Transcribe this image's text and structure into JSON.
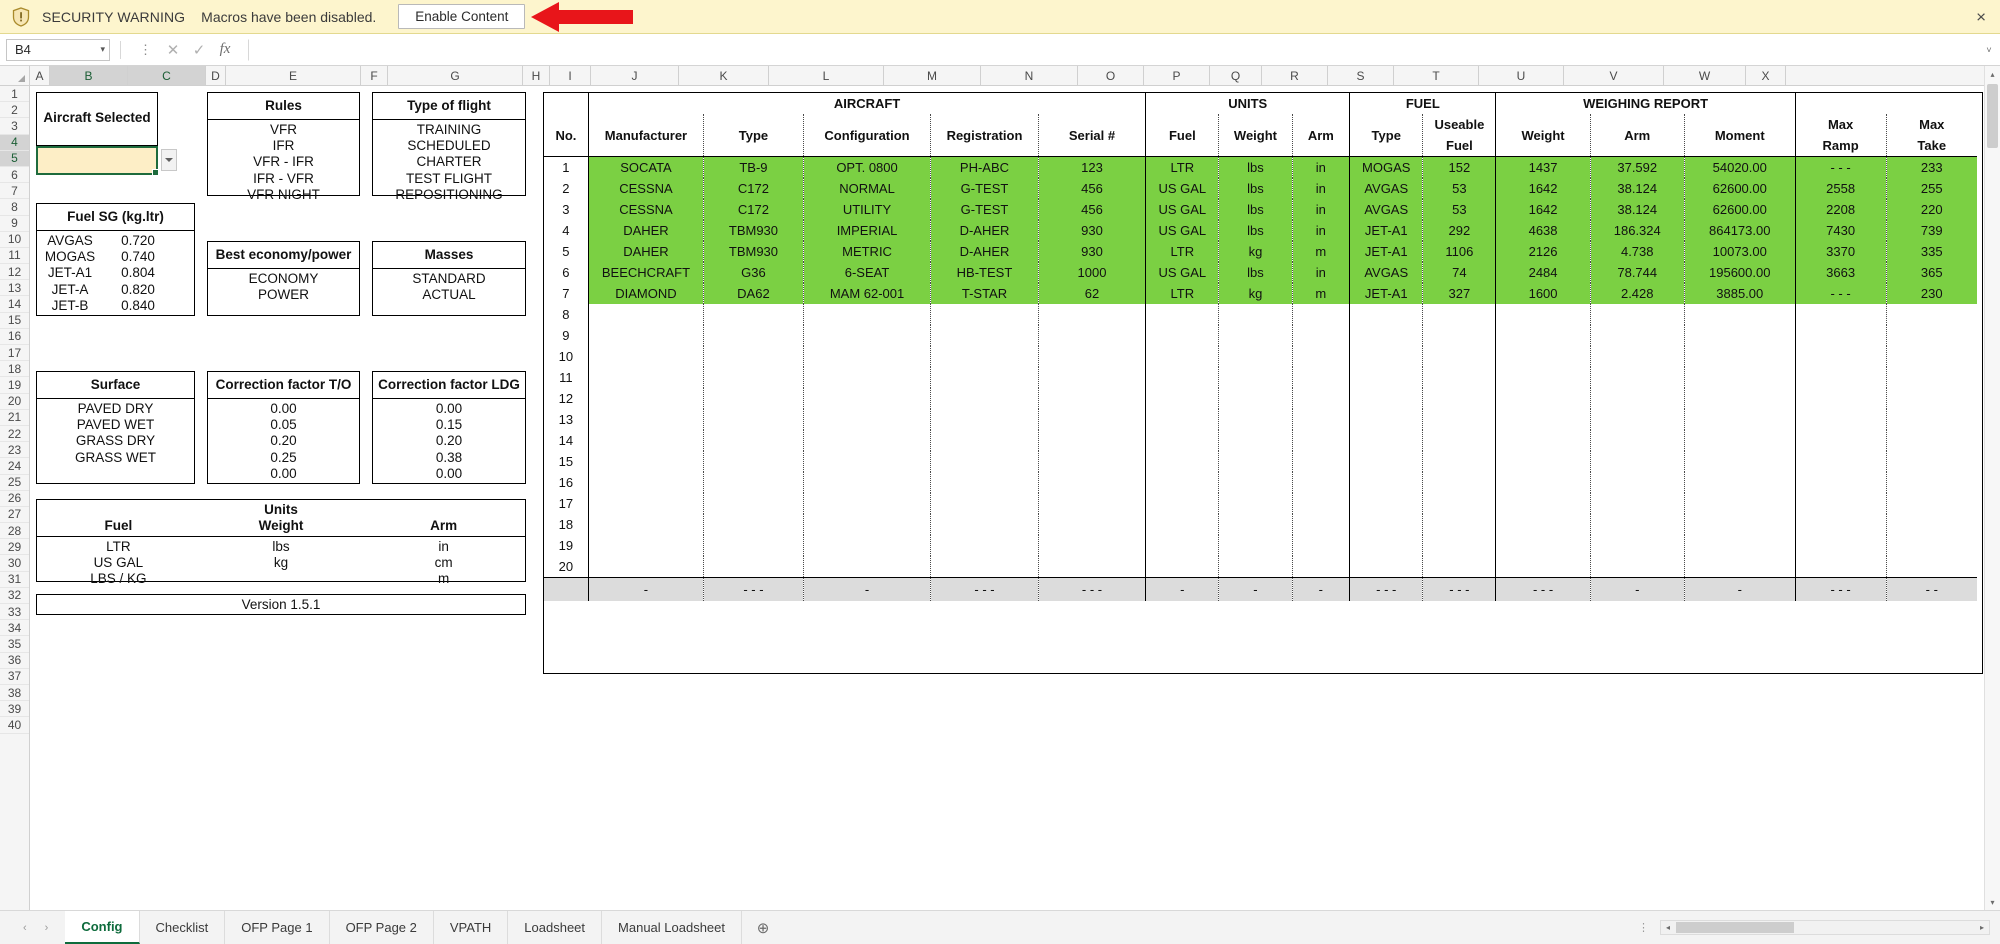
{
  "security_bar": {
    "icon": "shield-warning-icon",
    "title": "SECURITY WARNING",
    "message": "Macros have been disabled.",
    "button_label": "Enable Content",
    "close_label": "×",
    "background": "#fdf5cd",
    "arrow_color": "#e8151a"
  },
  "formula_bar": {
    "name_box_value": "B4",
    "name_box_chevron": "▾",
    "dots_icon": "more-options-icon",
    "cancel_icon": "✕",
    "confirm_icon": "✓",
    "function_icon": "fx",
    "formula_value": "",
    "expand_icon": "˅"
  },
  "grid": {
    "columns": [
      "A",
      "B",
      "C",
      "D",
      "E",
      "F",
      "G",
      "H",
      "I",
      "J",
      "K",
      "L",
      "M",
      "N",
      "O",
      "P",
      "Q",
      "R",
      "S",
      "T",
      "U",
      "V",
      "W",
      "X"
    ],
    "selected_columns": [
      "B",
      "C"
    ],
    "rows": [
      1,
      2,
      3,
      4,
      5,
      6,
      7,
      8,
      9,
      10,
      11,
      12,
      13,
      14,
      15,
      16,
      17,
      18,
      19,
      20,
      21,
      22,
      23,
      24,
      25,
      26,
      27,
      28,
      29,
      30,
      31,
      32,
      33,
      34,
      35,
      36,
      37,
      38,
      39,
      40
    ],
    "selected_rows": [
      4,
      5
    ]
  },
  "config": {
    "aircraft_selected": {
      "title": "Aircraft Selected",
      "value": "",
      "dropdown_icon": "chevron-down-icon"
    },
    "fuel_sg": {
      "title": "Fuel SG (kg.ltr)",
      "rows": [
        {
          "name": "AVGAS",
          "value": "0.720"
        },
        {
          "name": "MOGAS",
          "value": "0.740"
        },
        {
          "name": "JET-A1",
          "value": "0.804"
        },
        {
          "name": "JET-A",
          "value": "0.820"
        },
        {
          "name": "JET-B",
          "value": "0.840"
        }
      ]
    },
    "surface": {
      "title": "Surface",
      "items": [
        "PAVED DRY",
        "PAVED WET",
        "GRASS DRY",
        "GRASS WET"
      ]
    },
    "rules": {
      "title": "Rules",
      "items": [
        "VFR",
        "IFR",
        "VFR - IFR",
        "IFR - VFR",
        "VFR NIGHT"
      ]
    },
    "economy": {
      "title": "Best economy/power",
      "items": [
        "ECONOMY",
        "POWER"
      ]
    },
    "correction_to": {
      "title": "Correction factor T/O",
      "items": [
        "0.00",
        "0.05",
        "0.20",
        "0.25",
        "0.00"
      ]
    },
    "type_of_flight": {
      "title": "Type of flight",
      "items": [
        "TRAINING",
        "SCHEDULED",
        "CHARTER",
        "TEST FLIGHT",
        "REPOSITIONING"
      ]
    },
    "masses": {
      "title": "Masses",
      "items": [
        "STANDARD",
        "ACTUAL"
      ]
    },
    "correction_ldg": {
      "title": "Correction factor LDG",
      "items": [
        "0.00",
        "0.15",
        "0.20",
        "0.38",
        "0.00"
      ]
    },
    "units": {
      "title": "Units",
      "headers": [
        "Fuel",
        "Weight",
        "Arm"
      ],
      "rows": [
        [
          "LTR",
          "lbs",
          "in"
        ],
        [
          "US GAL",
          "kg",
          "cm"
        ],
        [
          "LBS / KG",
          "",
          "m"
        ]
      ]
    },
    "version": "Version 1.5.1"
  },
  "aircraft_table": {
    "group_headers": [
      {
        "label": "",
        "span": 1
      },
      {
        "label": "AIRCRAFT",
        "span": 5
      },
      {
        "label": "UNITS",
        "span": 3
      },
      {
        "label": "FUEL",
        "span": 2
      },
      {
        "label": "WEIGHING REPORT",
        "span": 3
      },
      {
        "label": "",
        "span": 2
      }
    ],
    "columns": [
      "No.",
      "Manufacturer",
      "Type",
      "Configuration",
      "Registration",
      "Serial #",
      "Fuel",
      "Weight",
      "Arm",
      "Type",
      "Useable Fuel",
      "Weight",
      "Arm",
      "Moment",
      "Max Ramp",
      "Max Take"
    ],
    "rows": [
      {
        "no": "1",
        "manufacturer": "SOCATA",
        "type": "TB-9",
        "configuration": "OPT. 0800",
        "registration": "PH-ABC",
        "serial": "123",
        "unit_fuel": "LTR",
        "unit_weight": "lbs",
        "unit_arm": "in",
        "fuel_type": "MOGAS",
        "useable_fuel": "152",
        "weight": "1437",
        "arm": "37.592",
        "moment": "54020.00",
        "max_ramp": "- - -",
        "max_takeoff": "233"
      },
      {
        "no": "2",
        "manufacturer": "CESSNA",
        "type": "C172",
        "configuration": "NORMAL",
        "registration": "G-TEST",
        "serial": "456",
        "unit_fuel": "US GAL",
        "unit_weight": "lbs",
        "unit_arm": "in",
        "fuel_type": "AVGAS",
        "useable_fuel": "53",
        "weight": "1642",
        "arm": "38.124",
        "moment": "62600.00",
        "max_ramp": "2558",
        "max_takeoff": "255"
      },
      {
        "no": "3",
        "manufacturer": "CESSNA",
        "type": "C172",
        "configuration": "UTILITY",
        "registration": "G-TEST",
        "serial": "456",
        "unit_fuel": "US GAL",
        "unit_weight": "lbs",
        "unit_arm": "in",
        "fuel_type": "AVGAS",
        "useable_fuel": "53",
        "weight": "1642",
        "arm": "38.124",
        "moment": "62600.00",
        "max_ramp": "2208",
        "max_takeoff": "220"
      },
      {
        "no": "4",
        "manufacturer": "DAHER",
        "type": "TBM930",
        "configuration": "IMPERIAL",
        "registration": "D-AHER",
        "serial": "930",
        "unit_fuel": "US GAL",
        "unit_weight": "lbs",
        "unit_arm": "in",
        "fuel_type": "JET-A1",
        "useable_fuel": "292",
        "weight": "4638",
        "arm": "186.324",
        "moment": "864173.00",
        "max_ramp": "7430",
        "max_takeoff": "739"
      },
      {
        "no": "5",
        "manufacturer": "DAHER",
        "type": "TBM930",
        "configuration": "METRIC",
        "registration": "D-AHER",
        "serial": "930",
        "unit_fuel": "LTR",
        "unit_weight": "kg",
        "unit_arm": "m",
        "fuel_type": "JET-A1",
        "useable_fuel": "1106",
        "weight": "2126",
        "arm": "4.738",
        "moment": "10073.00",
        "max_ramp": "3370",
        "max_takeoff": "335"
      },
      {
        "no": "6",
        "manufacturer": "BEECHCRAFT",
        "type": "G36",
        "configuration": "6-SEAT",
        "registration": "HB-TEST",
        "serial": "1000",
        "unit_fuel": "US GAL",
        "unit_weight": "lbs",
        "unit_arm": "in",
        "fuel_type": "AVGAS",
        "useable_fuel": "74",
        "weight": "2484",
        "arm": "78.744",
        "moment": "195600.00",
        "max_ramp": "3663",
        "max_takeoff": "365"
      },
      {
        "no": "7",
        "manufacturer": "DIAMOND",
        "type": "DA62",
        "configuration": "MAM 62-001",
        "registration": "T-STAR",
        "serial": "62",
        "unit_fuel": "LTR",
        "unit_weight": "kg",
        "unit_arm": "m",
        "fuel_type": "JET-A1",
        "useable_fuel": "327",
        "weight": "1600",
        "arm": "2.428",
        "moment": "3885.00",
        "max_ramp": "- - -",
        "max_takeoff": "230"
      }
    ],
    "empty_row_numbers": [
      "8",
      "9",
      "10",
      "11",
      "12",
      "13",
      "14",
      "15",
      "16",
      "17",
      "18",
      "19",
      "20"
    ],
    "summary_row": [
      "",
      "-",
      "- - -",
      "-",
      "- - -",
      "- - -",
      "-",
      "-",
      "-",
      "- - -",
      "- - -",
      "- - -",
      "-",
      "-",
      "- - -",
      "- -"
    ],
    "row_fill_color": "#7bd043",
    "summary_fill_color": "#dcdcdc"
  },
  "tab_bar": {
    "nav_prev_icon": "‹",
    "nav_next_icon": "›",
    "sheets": [
      {
        "label": "Config",
        "active": true
      },
      {
        "label": "Checklist",
        "active": false
      },
      {
        "label": "OFP Page 1",
        "active": false
      },
      {
        "label": "OFP Page 2",
        "active": false
      },
      {
        "label": "VPATH",
        "active": false
      },
      {
        "label": "Loadsheet",
        "active": false
      },
      {
        "label": "Manual Loadsheet",
        "active": false
      }
    ],
    "add_sheet_icon": "⊕",
    "grip_icon": "⋮",
    "scroll_left_icon": "◂",
    "scroll_right_icon": "▸"
  },
  "vertical_scrollbar": {
    "up_icon": "▴",
    "down_icon": "▾"
  }
}
